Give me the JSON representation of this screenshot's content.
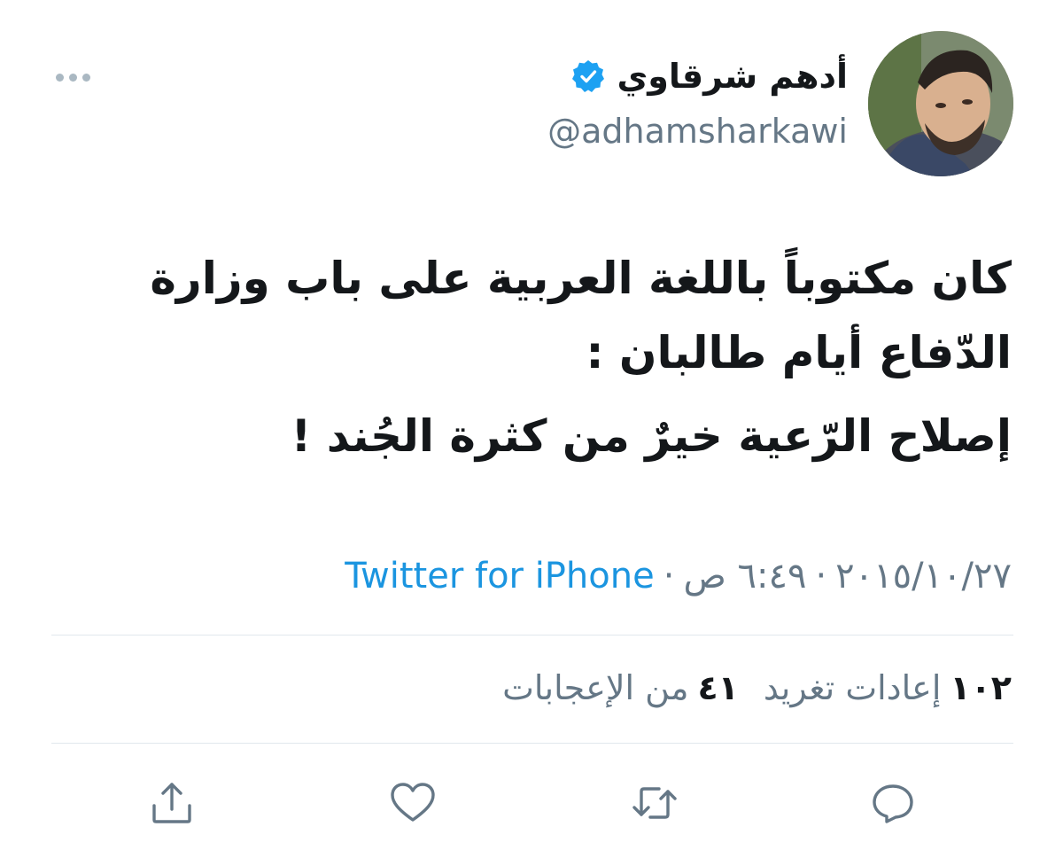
{
  "user": {
    "display_name": "أدهم شرقاوي",
    "handle": "@adhamsharkawi",
    "verified": true,
    "avatar_icon": "profile-photo"
  },
  "tweet": {
    "lines": [
      "كان مكتوباً باللغة العربية على باب وزارة",
      "الدّفاع أيام طالبان :",
      "إصلاح الرّعية خيرٌ من كثرة الجُند !"
    ]
  },
  "meta": {
    "date": "٢٠١٥/١٠/٢٧",
    "time": "٦:٤٩ ص",
    "separator": "·",
    "source": "Twitter for iPhone"
  },
  "stats": {
    "retweets_count": "١٠٢",
    "retweets_label": "إعادات تغريد",
    "likes_count": "٤١",
    "likes_label": "من الإعجابات"
  },
  "actions": {
    "reply_icon": "reply-icon",
    "retweet_icon": "retweet-icon",
    "like_icon": "heart-icon",
    "share_icon": "share-icon"
  },
  "colors": {
    "link": "#1b95e0",
    "muted": "#657786",
    "text": "#14171a",
    "divider": "#e1e8ed",
    "verified": "#1da1f2"
  }
}
